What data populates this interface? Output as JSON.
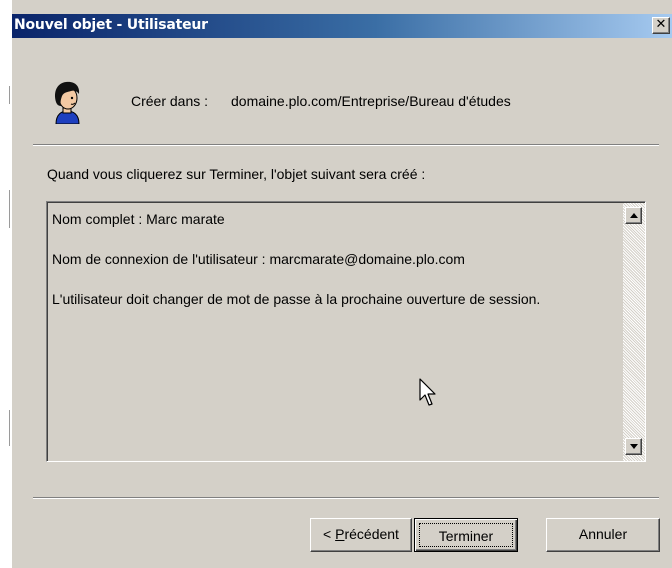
{
  "window": {
    "title": "Nouvel objet - Utilisateur",
    "close_glyph": "✕"
  },
  "header": {
    "icon": "user-icon",
    "create_label": "Créer dans :",
    "create_path": "domaine.plo.com/Entreprise/Bureau d'études"
  },
  "instruction": "Quand vous cliquerez sur Terminer, l'objet suivant sera créé :",
  "summary": {
    "lines": [
      "Nom complet : Marc marate",
      "Nom de connexion de l'utilisateur : marcmarate@domaine.plo.com",
      "L'utilisateur doit changer de mot de passe à la prochaine ouverture de session."
    ]
  },
  "buttons": {
    "previous_prefix": "< ",
    "previous_mnemonic": "P",
    "previous_rest": "récédent",
    "finish_label": "Terminer",
    "cancel_label": "Annuler"
  },
  "colors": {
    "face": "#d4d0c8",
    "title_start": "#0a246a",
    "title_end": "#a6caf0"
  }
}
